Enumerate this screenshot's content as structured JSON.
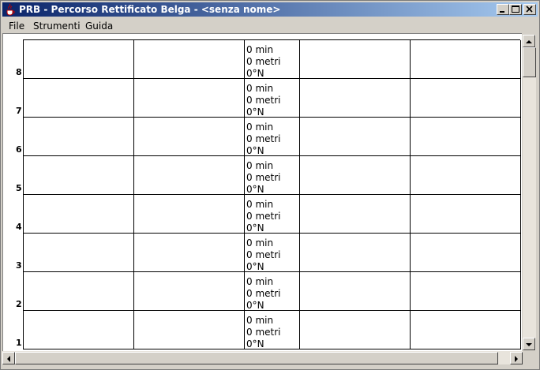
{
  "window": {
    "title": "PRB - Percorso Rettificato Belga - <senza nome>"
  },
  "menubar": {
    "items": [
      {
        "label": "File"
      },
      {
        "label": "Strumenti"
      },
      {
        "label": "Guida"
      }
    ]
  },
  "grid": {
    "row_labels": [
      "8",
      "7",
      "6",
      "5",
      "4",
      "3",
      "2",
      "1"
    ],
    "cells": [
      {
        "time": "0 min",
        "distance": "0 metri",
        "bearing": "0°N"
      },
      {
        "time": "0 min",
        "distance": "0 metri",
        "bearing": "0°N"
      },
      {
        "time": "0 min",
        "distance": "0 metri",
        "bearing": "0°N"
      },
      {
        "time": "0 min",
        "distance": "0 metri",
        "bearing": "0°N"
      },
      {
        "time": "0 min",
        "distance": "0 metri",
        "bearing": "0°N"
      },
      {
        "time": "0 min",
        "distance": "0 metri",
        "bearing": "0°N"
      },
      {
        "time": "0 min",
        "distance": "0 metri",
        "bearing": "0°N"
      },
      {
        "time": "0 min",
        "distance": "0 metri",
        "bearing": "0°N"
      }
    ]
  },
  "icons": {
    "app": "java-cup-icon",
    "minimize": "minimize-icon",
    "maximize": "maximize-icon",
    "close": "close-icon",
    "scroll_up": "arrow-up-icon",
    "scroll_down": "arrow-down-icon",
    "scroll_left": "arrow-left-icon",
    "scroll_right": "arrow-right-icon"
  },
  "colors": {
    "titlebar_start": "#0a246a",
    "titlebar_end": "#a6caf0",
    "chrome": "#d4d0c8",
    "grid_background": "#ffffff"
  }
}
